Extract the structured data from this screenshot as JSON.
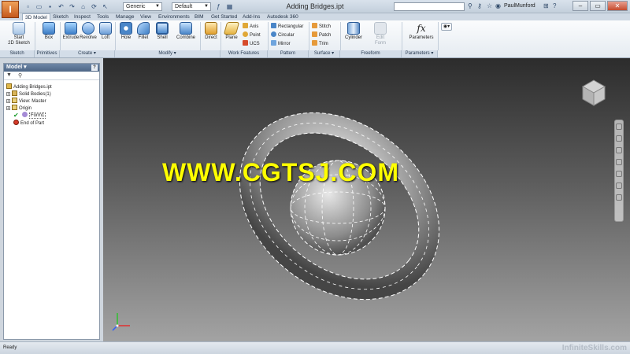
{
  "app": {
    "title": "Adding Bridges.ipt",
    "user": "PaulMunford",
    "logo_letter": "I",
    "material_combo": "Generic",
    "appearance_combo": "Default",
    "status": "Ready",
    "watermark": "WWW.CGTSJ.COM",
    "brand": "InfiniteSkills.com"
  },
  "tabs": [
    "3D Model",
    "Sketch",
    "Inspect",
    "Tools",
    "Manage",
    "View",
    "Environments",
    "BIM",
    "Get Started",
    "Add-Ins",
    "Autodesk 360"
  ],
  "ribbon": {
    "sketch": {
      "label": "Start\n2D Sketch",
      "panel": "Sketch"
    },
    "box": {
      "label": "Box",
      "panel": "Primitives"
    },
    "extrude": "Extrude",
    "revolve": "Revolve",
    "loft": "Loft",
    "create_panel": "Create ▾",
    "hole": "Hole",
    "fillet": "Fillet",
    "shell": "Shell",
    "combine": "Combine",
    "direct": "Direct",
    "modify_panel": "Modify ▾",
    "plane": "Plane",
    "axis": "Axis",
    "point": "Point",
    "ucs": "UCS",
    "work_panel": "Work Features",
    "rectangular": "Rectangular",
    "circular": "Circular",
    "mirror": "Mirror",
    "pattern_panel": "Pattern",
    "stitch": "Stitch",
    "patch": "Patch",
    "trim": "Trim",
    "surface_panel": "Surface ▾",
    "cylinder": "Cylinder",
    "edit_form": "Edit\nForm",
    "freeform_panel": "Freeform",
    "parameters": "Parameters",
    "fx": "fx",
    "parameters_panel": "Parameters ▾"
  },
  "browser": {
    "title": "Model ▾",
    "help": "?",
    "items": [
      {
        "label": "Adding Bridges.ipt",
        "depth": 0
      },
      {
        "label": "Solid Bodies(1)",
        "depth": 1
      },
      {
        "label": "View: Master",
        "depth": 1
      },
      {
        "label": "Origin",
        "depth": 1
      },
      {
        "label": "Form1",
        "depth": 1
      },
      {
        "label": "End of Part",
        "depth": 1
      }
    ]
  },
  "colors": {
    "accent": "#4e6686",
    "watermark": "#ffff00",
    "viewport_top": "#2c2c2c",
    "viewport_bottom": "#a3a3a3"
  }
}
